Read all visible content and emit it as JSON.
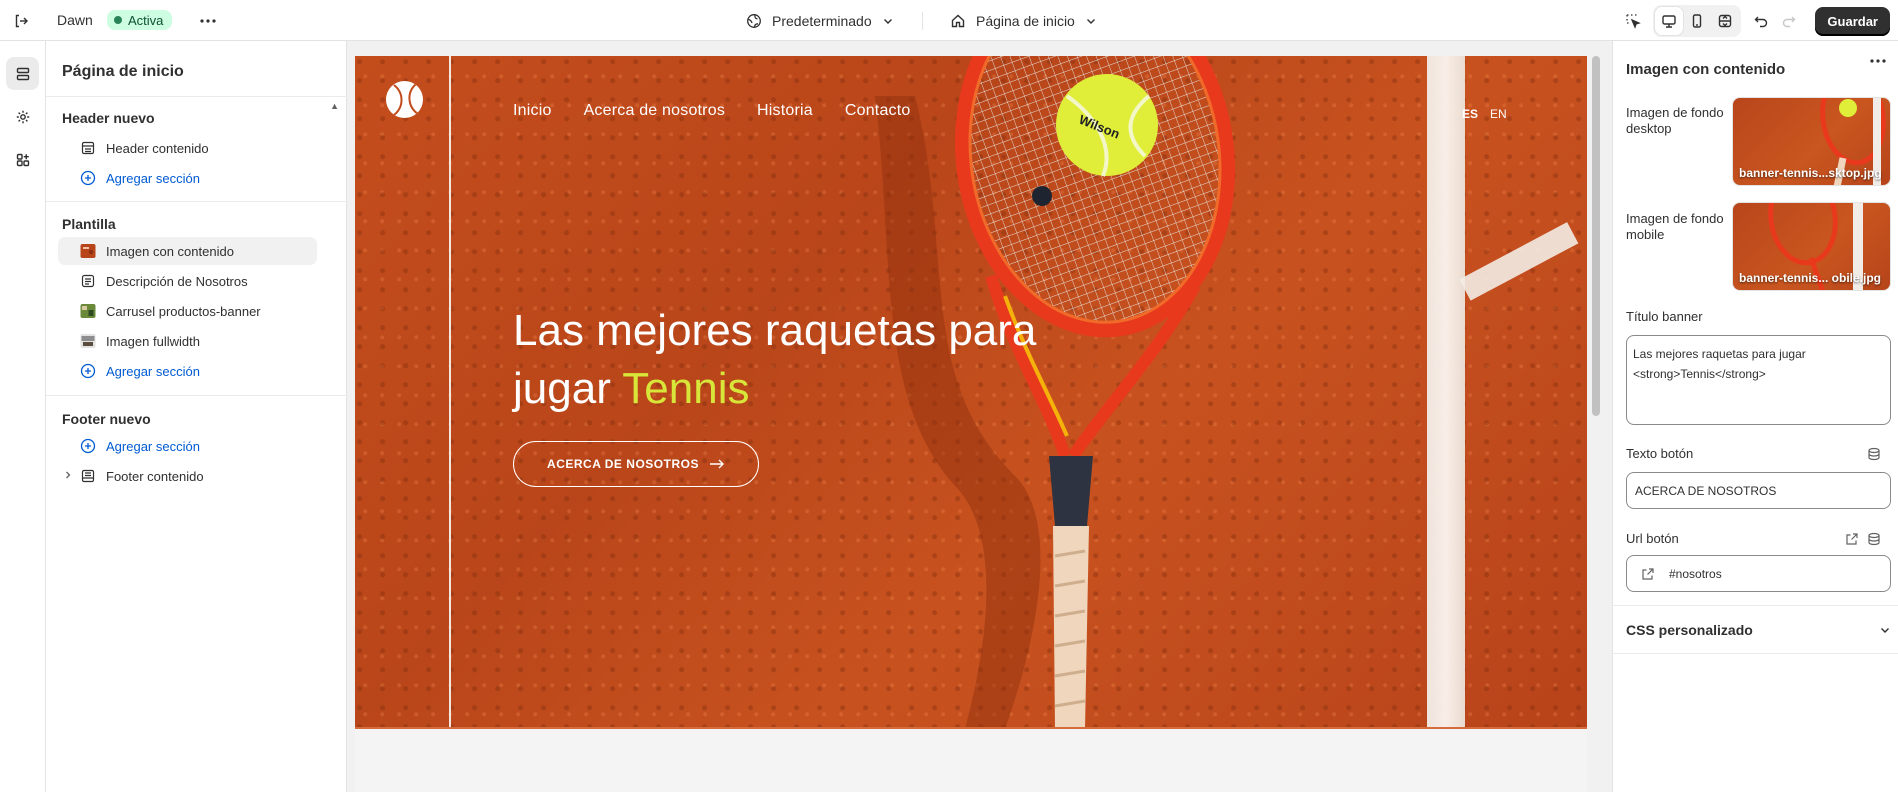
{
  "topbar": {
    "theme_name": "Dawn",
    "status_badge": "Activa",
    "preset_label": "Predeterminado",
    "page_label": "Página de inicio",
    "save_label": "Guardar"
  },
  "sidebar": {
    "title": "Página de inicio",
    "groups": [
      {
        "title": "Header nuevo",
        "items": [
          {
            "label": "Header contenido",
            "icon": "layout-header-icon"
          },
          {
            "label": "Agregar sección",
            "icon": "plus-circle-icon"
          }
        ]
      },
      {
        "title": "Plantilla",
        "items": [
          {
            "label": "Imagen con contenido",
            "icon": "image-thumbnail-icon",
            "selected": true
          },
          {
            "label": "Descripción de Nosotros",
            "icon": "text-block-icon"
          },
          {
            "label": "Carrusel productos-banner",
            "icon": "image-thumbnail-icon"
          },
          {
            "label": "Imagen fullwidth",
            "icon": "image-thumbnail-icon"
          },
          {
            "label": "Agregar sección",
            "icon": "plus-circle-icon"
          }
        ]
      },
      {
        "title": "Footer nuevo",
        "items": [
          {
            "label": "Agregar sección",
            "icon": "plus-circle-icon"
          },
          {
            "label": "Footer contenido",
            "icon": "layout-footer-icon"
          }
        ]
      }
    ]
  },
  "preview": {
    "nav": [
      "Inicio",
      "Acerca de nosotros",
      "Historia",
      "Contacto"
    ],
    "languages": [
      "ES",
      "EN"
    ],
    "hero_title_part1": "Las mejores raquetas para",
    "hero_title_part2": "jugar ",
    "hero_title_highlight": "Tennis",
    "hero_button": "ACERCA DE NOSOTROS",
    "highlight_color": "#d8e63a",
    "banner_color": "#c24b1c"
  },
  "settings": {
    "title": "Imagen con contenido",
    "bg_desktop_label": "Imagen de fondo desktop",
    "bg_desktop_file": "banner-tennis...sktop.jpg",
    "bg_mobile_label": "Imagen de fondo mobile",
    "bg_mobile_file": "banner-tennis... obile.jpg",
    "title_banner_label": "Título banner",
    "title_banner_value": "Las mejores raquetas para jugar <strong>Tennis</strong>",
    "button_text_label": "Texto botón",
    "button_text_value": "ACERCA DE NOSOTROS",
    "button_url_label": "Url botón",
    "button_url_value": "#nosotros",
    "css_label": "CSS personalizado"
  }
}
